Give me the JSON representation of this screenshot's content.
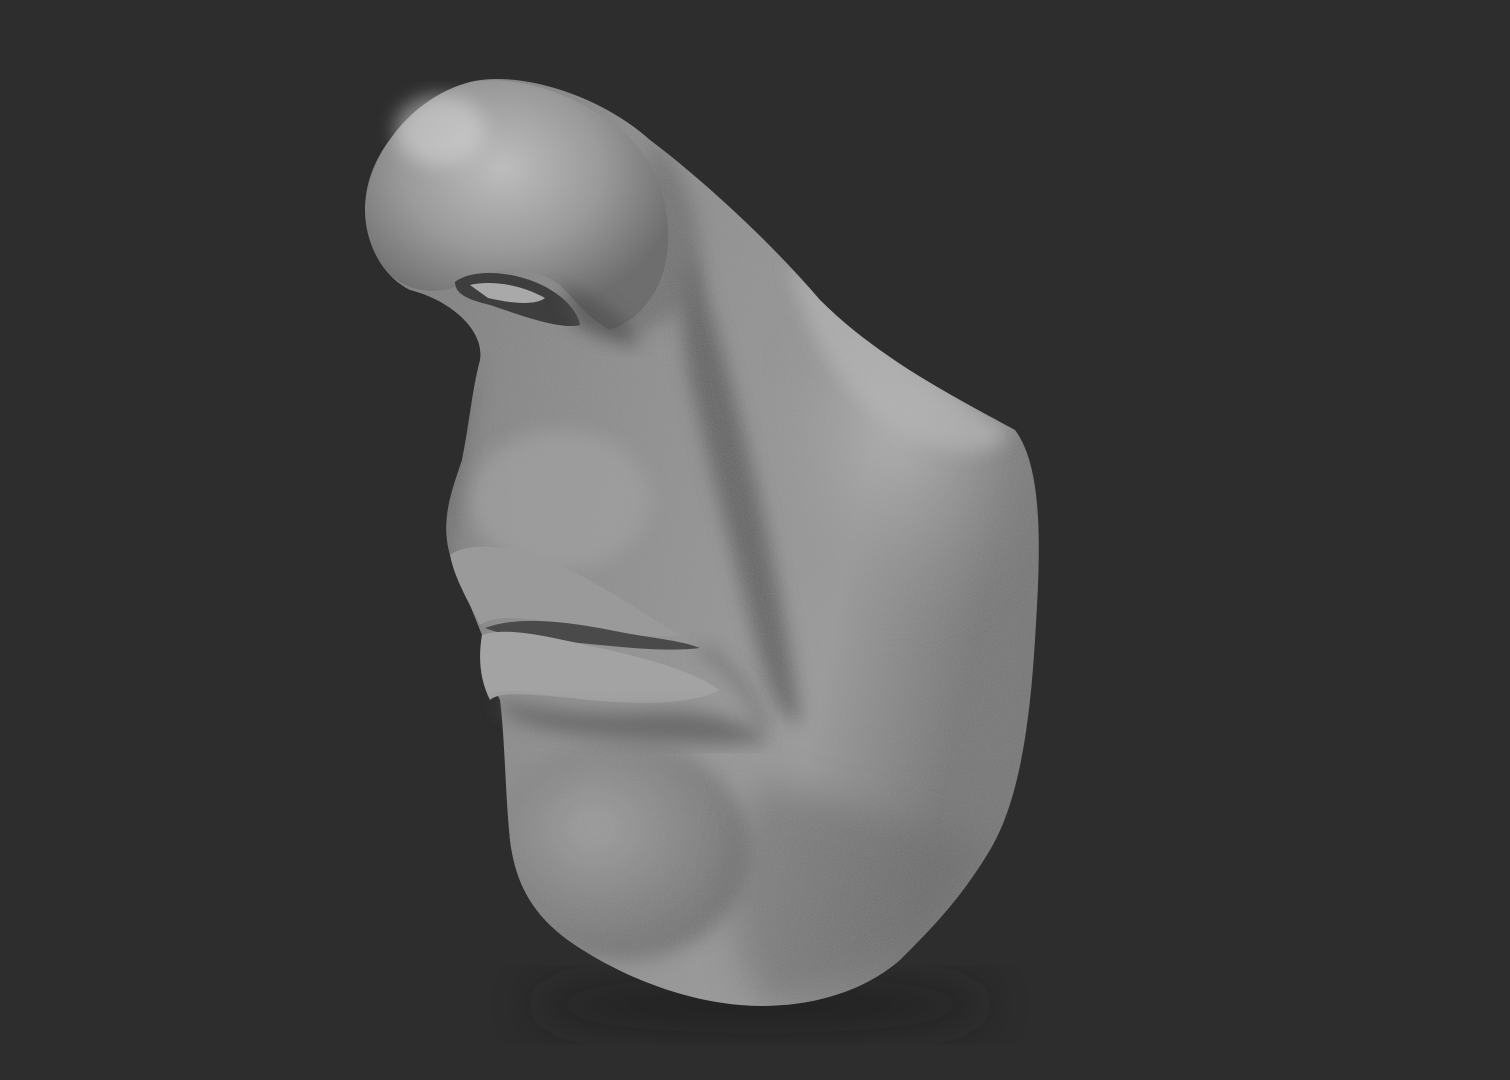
{
  "scene": {
    "background_color": "#2d2d2e",
    "material_color": "#8e8e8e",
    "subject": "sculpt-nose-mouth-fragment"
  }
}
